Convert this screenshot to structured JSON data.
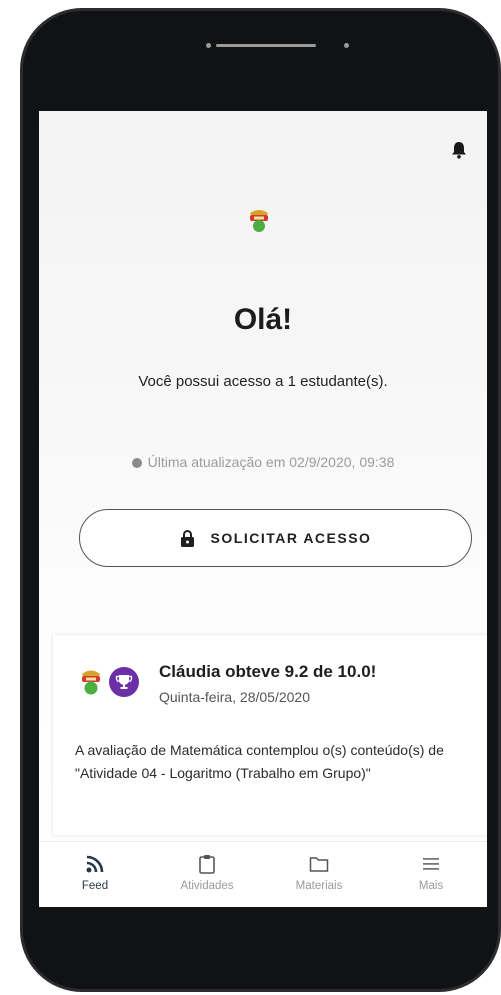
{
  "header": {
    "greeting": "Olá!",
    "access_text": "Você possui acesso a 1 estudante(s).",
    "last_update": "Última atualização em 02/9/2020, 09:38",
    "request_button": "SOLICITAR ACESSO"
  },
  "feed_card": {
    "title": "Cláudia obteve 9.2 de 10.0!",
    "date": "Quinta-feira, 28/05/2020",
    "body": "A avaliação de Matemática contemplou o(s) conteúdo(s) de \"Atividade 04 - Logaritmo (Trabalho em Grupo)\"",
    "badge_icon": "trophy-icon"
  },
  "bottom_nav": {
    "items": [
      {
        "label": "Feed",
        "icon": "rss-feed-icon",
        "active": true
      },
      {
        "label": "Atividades",
        "icon": "clipboard-icon",
        "active": false
      },
      {
        "label": "Materiais",
        "icon": "folder-icon",
        "active": false
      },
      {
        "label": "Mais",
        "icon": "menu-icon",
        "active": false
      }
    ]
  },
  "colors": {
    "accent": "#27384d",
    "badge": "#6d2fa8",
    "muted": "#9a9a9a"
  }
}
